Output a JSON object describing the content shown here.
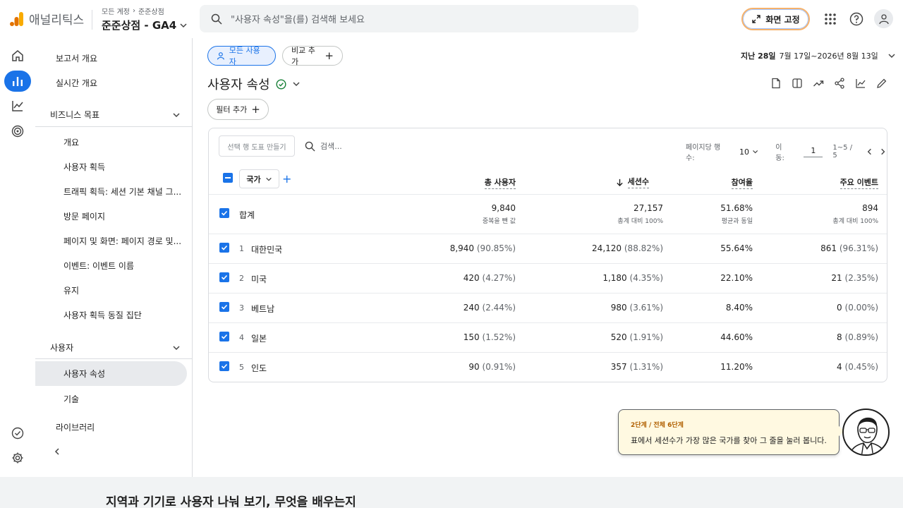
{
  "header": {
    "app_name": "애널리틱스",
    "breadcrumb_parent": "모든 계정",
    "breadcrumb_child": "준준상점",
    "property_name": "준준상점 - GA4",
    "search_placeholder": "\"사용자 속성\"을(를) 검색해 보세요",
    "pin_label": "화면 고정"
  },
  "nav": {
    "items": [
      "보고서 개요",
      "실시간 개요"
    ],
    "section_business": "비즈니스 목표",
    "business_items": [
      "개요",
      "사용자 획득",
      "트래픽 획득: 세션 기본 채널 그...",
      "방문 페이지",
      "페이지 및 화면: 페이지 경로 및...",
      "이벤트: 이벤트 이름",
      "유지",
      "사용자 획득 동질 집단"
    ],
    "section_user": "사용자",
    "user_items": [
      "사용자 속성",
      "기술"
    ],
    "library": "라이브러리"
  },
  "main": {
    "segment_chip": "모든 사용자",
    "compare_chip": "비교 추가",
    "date_prefix": "지난 28일",
    "date_range": "7월 17일~2026년 8월 13일",
    "title": "사용자 속성",
    "filter_chip": "필터 추가"
  },
  "table": {
    "chart_button": "선택 행 도표 만들기",
    "search_placeholder": "검색...",
    "rows_per_page_label": "페이지당 행 수:",
    "rows_per_page": "10",
    "goto_label": "이동:",
    "goto_value": "1",
    "range": "1~5 / 5",
    "dimension": "국가",
    "columns": [
      "총 사용자",
      "세션수",
      "참여율",
      "주요 이벤트"
    ],
    "totals": {
      "label": "합계",
      "values": [
        "9,840",
        "27,157",
        "51.68%",
        "894"
      ],
      "subs": [
        "중복을 뺀 값",
        "총계 대비 100%",
        "평균과 동일",
        "총계 대비 100%"
      ]
    },
    "rows": [
      {
        "num": "1",
        "country": "대한민국",
        "users": "8,940",
        "users_pct": "(90.85%)",
        "sessions": "24,120",
        "sessions_pct": "(88.82%)",
        "engagement": "55.64%",
        "events": "861",
        "events_pct": "(96.31%)"
      },
      {
        "num": "2",
        "country": "미국",
        "users": "420",
        "users_pct": "(4.27%)",
        "sessions": "1,180",
        "sessions_pct": "(4.35%)",
        "engagement": "22.10%",
        "events": "21",
        "events_pct": "(2.35%)"
      },
      {
        "num": "3",
        "country": "베트남",
        "users": "240",
        "users_pct": "(2.44%)",
        "sessions": "980",
        "sessions_pct": "(3.61%)",
        "engagement": "8.40%",
        "events": "0",
        "events_pct": "(0.00%)"
      },
      {
        "num": "4",
        "country": "일본",
        "users": "150",
        "users_pct": "(1.52%)",
        "sessions": "520",
        "sessions_pct": "(1.91%)",
        "engagement": "44.60%",
        "events": "8",
        "events_pct": "(0.89%)"
      },
      {
        "num": "5",
        "country": "인도",
        "users": "90",
        "users_pct": "(0.91%)",
        "sessions": "357",
        "sessions_pct": "(1.31%)",
        "engagement": "11.20%",
        "events": "4",
        "events_pct": "(0.45%)"
      }
    ]
  },
  "tooltip": {
    "step": "2단계 / 전체 6단계",
    "text": "표에서 세션수가 가장 많은 국가를 찾아 그 줄을 눌러 봅니다."
  },
  "bottom_title": "지역과 기기로 사용자 나눠 보기, 무엇을 배우는지"
}
